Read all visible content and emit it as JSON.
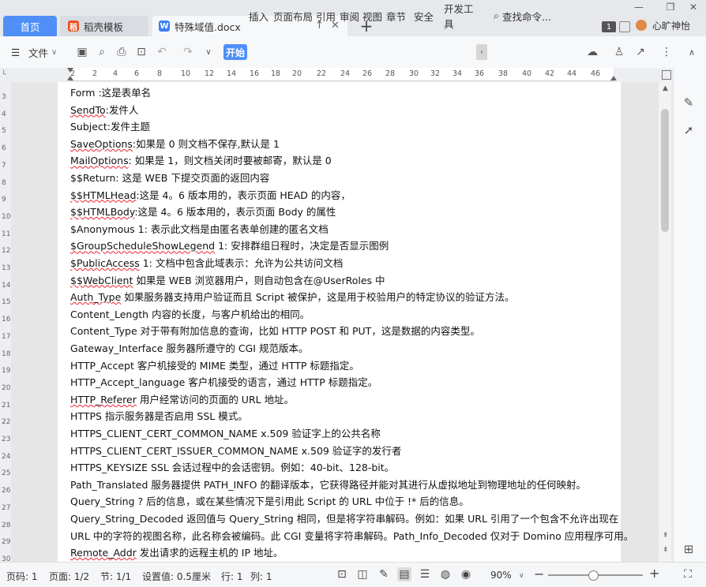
{
  "tabs": {
    "home": "首页",
    "daoke": "稻壳模板",
    "doc": "特殊域值.docx"
  },
  "window": {
    "page_count": "1",
    "username": "心旷神怡"
  },
  "toolbar": {
    "file": "文件",
    "start": "开始",
    "menus": [
      "插入",
      "页面布局",
      "引用",
      "审阅",
      "视图",
      "章节",
      "安全",
      "开发工具"
    ],
    "search": "查找命令..."
  },
  "ruler": {
    "h_ticks": [
      "2",
      "2",
      "4",
      "6",
      "8",
      "10",
      "12",
      "14",
      "16",
      "18",
      "20",
      "22",
      "24",
      "26",
      "28",
      "30",
      "32",
      "34",
      "36",
      "38",
      "40",
      "42",
      "44",
      "46"
    ],
    "v_ticks": [
      "3",
      "4",
      "5",
      "6",
      "7",
      "8",
      "9",
      "10",
      "11",
      "12",
      "13",
      "14",
      "15",
      "16",
      "17",
      "18",
      "19",
      "20",
      "21",
      "22",
      "23",
      "24",
      "25",
      "26",
      "27",
      "28",
      "29",
      "30"
    ]
  },
  "document": {
    "lines": [
      {
        "head": "Form",
        "rest": " :这是表单名"
      },
      {
        "head": "SendTo",
        "rest": ":发件人"
      },
      {
        "head": "Subject",
        "rest": ":发件主题"
      },
      {
        "head": "SaveOptions",
        "rest": ":如果是 0 则文档不保存,默认是 1"
      },
      {
        "head": "MailOptions",
        "rest": ": 如果是 1，则文档关闭时要被邮寄，默认是 0"
      },
      {
        "head": "$$Return",
        "rest": ": 这是 WEB 下提交页面的返回内容"
      },
      {
        "head": "$$HTMLHead",
        "rest": ":这是 4。6 版本用的，表示页面 HEAD 的内容，"
      },
      {
        "head": "$$HTMLBody",
        "rest": ":这是 4。6 版本用的，表示页面 Body 的属性"
      },
      {
        "head": "$Anonymous",
        "rest": " 1: 表示此文档是由匿名表单创建的匿名文档"
      },
      {
        "head": "$GroupScheduleShowLegend",
        "rest": " 1: 安排群组日程时，决定是否显示图例"
      },
      {
        "head": "$PublicAccess",
        "rest": " 1: 文档中包含此域表示：允许为公共访问文档"
      },
      {
        "head": "$$WebClient",
        "rest": " 如果是 WEB 浏览器用户，则自动包含在@UserRoles 中"
      },
      {
        "head": "Auth_Type",
        "rest": " 如果服务器支持用户验证而且  Script  被保护，这是用于校验用户的特定协议的验证方法。"
      },
      {
        "head": "Content_Length",
        "rest": " 内容的长度，与客户机给出的相同。"
      },
      {
        "head": "Content_Type",
        "rest": " 对于带有附加信息的查询，比如  HTTP POST  和  PUT，这是数据的内容类型。"
      },
      {
        "head": "Gateway_Interface",
        "rest": " 服务器所遵守的  CGI  规范版本。"
      },
      {
        "head": "HTTP_Accept",
        "rest": " 客户机接受的  MIME  类型，通过  HTTP  标题指定。"
      },
      {
        "head": "HTTP_Accept_language",
        "rest": " 客户机接受的语言，通过  HTTP  标题指定。"
      },
      {
        "head": "HTTP_Referer",
        "rest": " 用户经常访问的页面的  URL  地址。"
      },
      {
        "head": "HTTPS",
        "rest": " 指示服务器是否启用  SSL  模式。"
      },
      {
        "head": "HTTPS_CLIENT_CERT_COMMON_NAME",
        "rest": " x.509 验证字上的公共名称"
      },
      {
        "head": "HTTPS_CLIENT_CERT_ISSUER_COMMON_NAME",
        "rest": " x.509 验证字的发行者"
      },
      {
        "head": "HTTPS_KEYSIZE",
        "rest": " SSL 会话过程中的会话密钥。例如：40-bit、128-bit。"
      },
      {
        "head": "Path_Translated",
        "rest": " 服务器提供  PATH_INFO  的翻译版本，它获得路径并能对其进行从虚拟地址到物理地址的任何映射。"
      },
      {
        "head": "Query_String",
        "rest": " ? 后的信息，或在某些情况下是引用此  Script  的  URL  中位于  !*  后的信息。"
      },
      {
        "head": "Query_String_Decoded",
        "rest": " 返回值与  Query_String  相同，但是将字符串解码。例如：如果  URL  引用了一个包含不允许出现在"
      },
      {
        "head": "",
        "rest": "URL 中的字符的视图名称，此名称会被编码。此  CGI  变量将字符串解码。Path_Info_Decoded 仅对于  Domino  应用程序可用。"
      },
      {
        "head": "Remote_Addr",
        "rest": " 发出请求的远程主机的  IP  地址。"
      }
    ]
  },
  "status": {
    "page_num": "页码: 1",
    "pages": "页面: 1/2",
    "section": "节: 1/1",
    "setting": "设置值: 0.5厘米",
    "row": "行: 1",
    "col": "列: 1",
    "zoom": "90%"
  },
  "colors": {
    "accent": "#4f8ff7",
    "squiggle": "#e23"
  }
}
